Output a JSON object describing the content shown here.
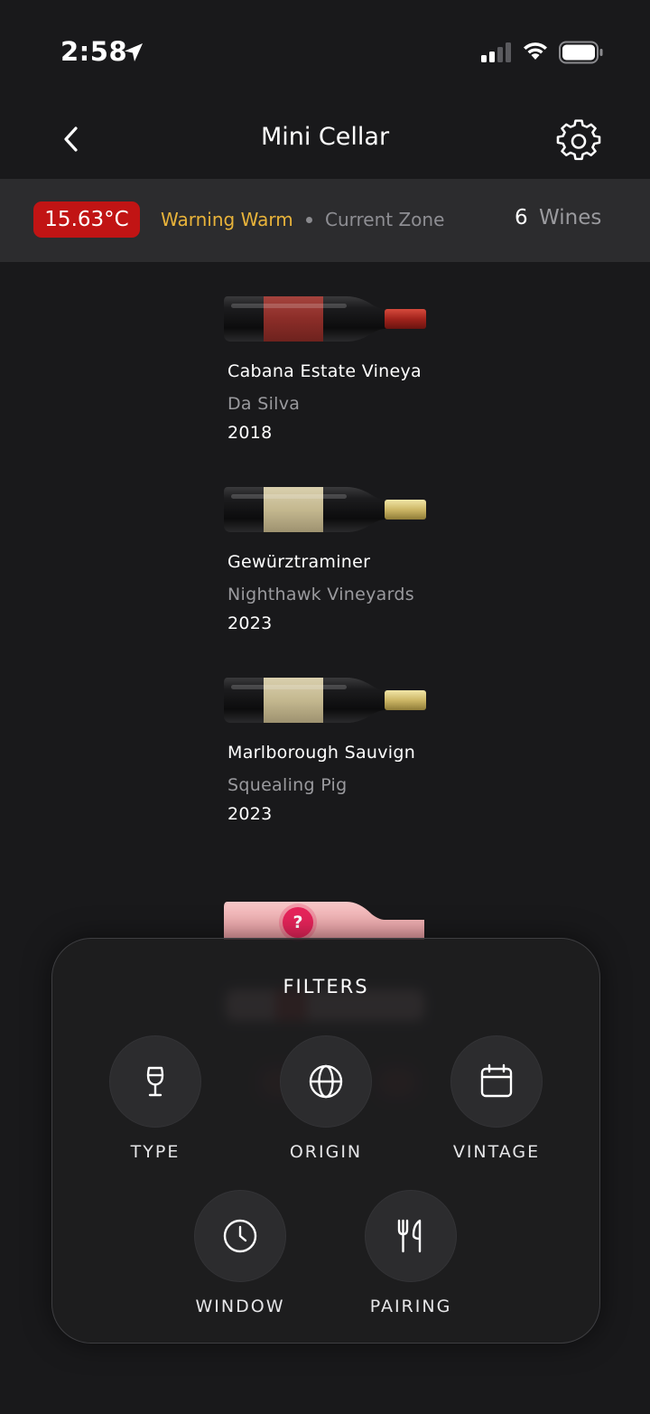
{
  "status_bar": {
    "time": "2:58",
    "icons": [
      "location-arrow-icon",
      "cellular-signal-icon",
      "wifi-icon",
      "battery-icon"
    ]
  },
  "nav": {
    "title": "Mini Cellar",
    "back_icon": "chevron-left-icon",
    "settings_icon": "gear-icon"
  },
  "zone": {
    "temperature": "15.63°C",
    "warning": "Warning Warm",
    "zone_label": "Current Zone",
    "wine_count": "6",
    "wine_count_label": "Wines",
    "colors": {
      "badge": "#c11414",
      "warning": "#e8b33a"
    }
  },
  "wines": [
    {
      "name": "Cabana Estate Vineya",
      "producer": "Da Silva",
      "year": "2018",
      "bottle_type": "red"
    },
    {
      "name": "Gewürztraminer",
      "producer": "Nighthawk Vineyards",
      "year": "2023",
      "bottle_type": "white"
    },
    {
      "name": "Marlborough Sauvign",
      "producer": "Squealing Pig",
      "year": "2023",
      "bottle_type": "white"
    }
  ],
  "partial_bottle": {
    "type": "rose",
    "badge": "?"
  },
  "filters": {
    "title": "FILTERS",
    "items": [
      {
        "label": "TYPE",
        "icon": "wine-glass-icon"
      },
      {
        "label": "ORIGIN",
        "icon": "globe-icon"
      },
      {
        "label": "VINTAGE",
        "icon": "calendar-icon"
      },
      {
        "label": "WINDOW",
        "icon": "clock-icon"
      },
      {
        "label": "PAIRING",
        "icon": "fork-knife-icon"
      }
    ]
  }
}
